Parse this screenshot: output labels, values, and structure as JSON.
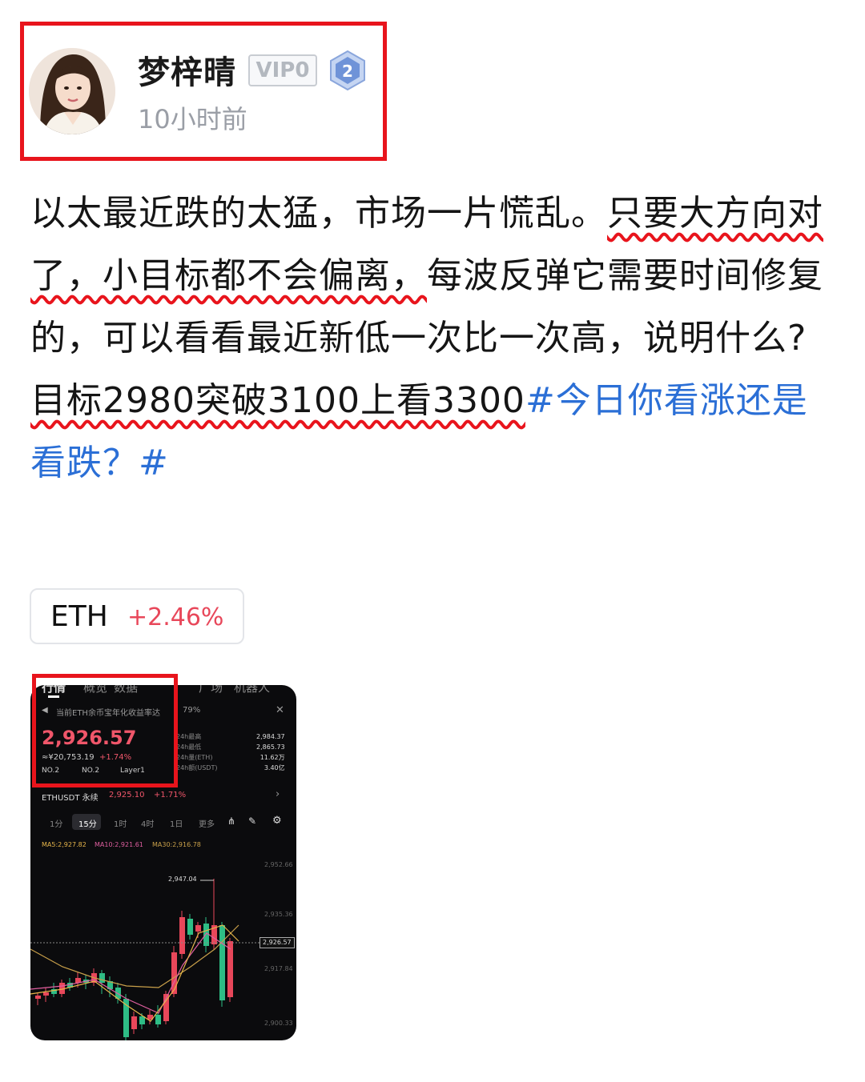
{
  "author": {
    "name": "梦梓晴",
    "vip_label": "VIP0",
    "level": "2",
    "time": "10小时前"
  },
  "post": {
    "p1_a": "以太最近跌的太猛，市场一片慌乱。",
    "p1_b": "只要大方向对了，小目标都不会偏离，",
    "p1_c": "每波反弹它需要时间修复的，可以看看最近新低一次比一次高，说明什么?",
    "p2_a": "目标2980突破3100上看3300",
    "p2_hashtag": "#今日你看涨还是看跌？#"
  },
  "ticker": {
    "symbol": "ETH",
    "change": "+2.46%"
  },
  "thumbnail": {
    "tabs": [
      "行情",
      "概览",
      "数据",
      "广场",
      "机器人"
    ],
    "notice": "当前ETH余币宝年化收益率达",
    "notice_rate": "79%",
    "price": "2,926.57",
    "cny": "≈¥20,753.19",
    "change": "+1.74%",
    "tags": [
      "NO.2",
      "NO.2",
      "Layer1"
    ],
    "stats_labels": [
      "24h最高",
      "24h最低",
      "24h量(ETH)",
      "24h额(USDT)"
    ],
    "stats_values": [
      "2,984.37",
      "2,865.73",
      "11.62万",
      "3.40亿"
    ],
    "perp": "ETHUSDT 永续",
    "perp_price": "2,925.10",
    "perp_change": "+1.71%",
    "intervals": [
      "1分",
      "15分",
      "1时",
      "4时",
      "1日",
      "更多"
    ],
    "ma": [
      "MA5:2,927.82",
      "MA10:2,921.61",
      "MA30:2,916.78"
    ],
    "y_ticks": [
      "2,952.66",
      "2,935.36",
      "2,917.84",
      "2,900.33"
    ],
    "high_label": "2,947.04",
    "last_price": "2,926.57"
  },
  "colors": {
    "accent_red": "#e8141c",
    "hashtag_blue": "#2b6fd6",
    "up_red": "#e8475a",
    "down_green": "#2ebd85"
  }
}
